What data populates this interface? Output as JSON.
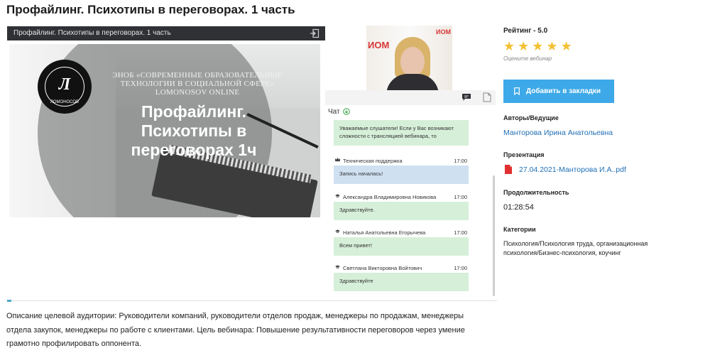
{
  "page": {
    "title": "Профайлинг. Психотипы в переговорах. 1 часть"
  },
  "player": {
    "bar_title": "Профайлинг. Психотипы в переговорах. 1 часть",
    "exit_icon": "exit-icon",
    "slide": {
      "logo_letter": "Л",
      "logo_text": "ЛОМОНОСОВ",
      "org_text": "ЭНОБ «СОВРЕМЕННЫЕ ОБРАЗОВАТЕЛЬНЫЕ ТЕХНОЛОГИИ В СОЦИАЛЬНОЙ СФЕРЕ» LOMONOSOV ONLINE",
      "heading": "Профайлинг. Психотипы в переговорах 1ч"
    },
    "video": {
      "brand_left": "ИОМ",
      "brand_right": "ИОМ"
    }
  },
  "chat": {
    "label": "Чат",
    "messages": [
      {
        "author": "",
        "time": "",
        "text": "Уважаемые слушатели! Если у Вас возникают сложности с трансляцией вебинара, то",
        "style": "green"
      },
      {
        "author": "Техническая поддержка",
        "time": "17:00",
        "text": "Запись началась!",
        "style": "blue"
      },
      {
        "author": "Александра Владимировна Новикова",
        "time": "17:00",
        "text": "Здравствуйте.",
        "style": "green"
      },
      {
        "author": "Наталья Анатольевна Егорычева",
        "time": "17:00",
        "text": "Всем привет!",
        "style": "green"
      },
      {
        "author": "Светлана Викторовна Войтович",
        "time": "17:00",
        "text": "Здравствуйте",
        "style": "green"
      }
    ]
  },
  "description": "Описание целевой аудитории: Руководители компаний, руководители отделов продаж, менеджеры по продажам, менеджеры отдела закупок, менеджеры по работе с клиентами. Цель вебинара: Повышение результативности переговоров через умение грамотно профилировать оппонента.",
  "sidebar": {
    "rating_label": "Рейтинг - 5.0",
    "stars": 5,
    "star_color": "#f4c033",
    "rate_hint": "Оцените вебинар",
    "bookmark_label": "Добавить в закладки",
    "bookmark_color": "#3da9e8",
    "authors_label": "Авторы/Ведущие",
    "author_name": "Манторова Ирина Анатольевна",
    "presentation_label": "Презентация",
    "presentation_file": "27.04.2021-Манторова И.А..pdf",
    "duration_label": "Продолжительность",
    "duration": "01:28:54",
    "categories_label": "Категории",
    "categories": "Психология/Психология труда, организационная психология/Бизнес-психология, коучинг",
    "link_color": "#1f6fb5"
  }
}
